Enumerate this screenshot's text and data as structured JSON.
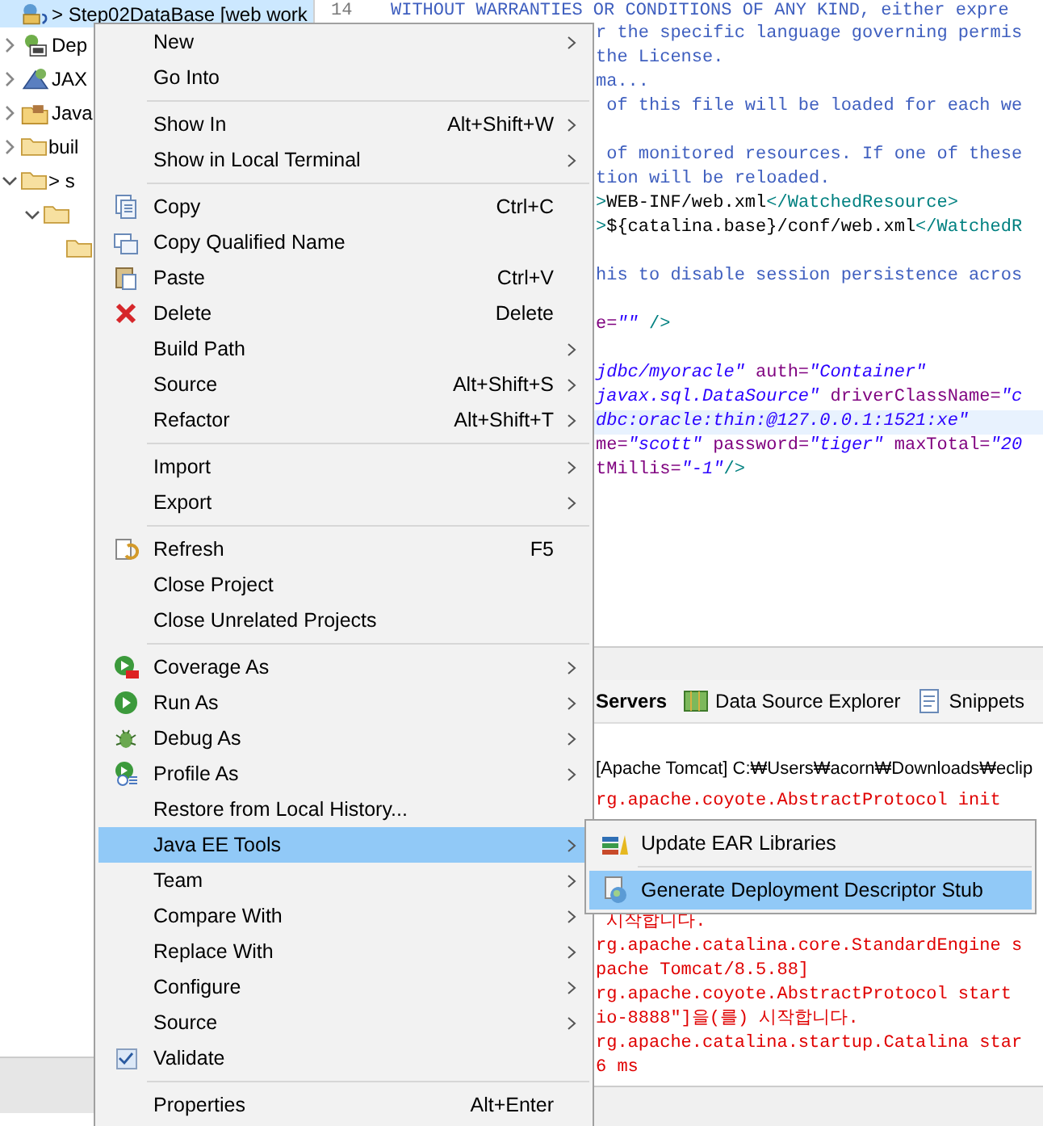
{
  "tree": [
    {
      "label": "> Step02DataBase [web work",
      "selected": true
    },
    {
      "label": "Dep",
      "expanded": false,
      "selected": false
    },
    {
      "label": "JAX",
      "expanded": false,
      "selected": false
    },
    {
      "label": "Java",
      "expanded": false,
      "selected": false
    },
    {
      "label": "buil",
      "expanded": false,
      "selected": false
    },
    {
      "label": "> s",
      "expanded": true,
      "selected": false,
      "children": [
        {
          "expanded": true,
          "selected": false,
          "children": [
            {
              "selected": false
            }
          ]
        }
      ]
    }
  ],
  "editor": {
    "line_number": "14",
    "first_line": "WITHOUT WARRANTIES OR CONDITIONS OF ANY KIND, either expre",
    "lines": [
      {
        "kind": "code",
        "current": false,
        "segments": [
          {
            "kind": "comment",
            "text": "r the specific language governing permis"
          }
        ]
      },
      {
        "kind": "code",
        "current": false,
        "segments": [
          {
            "kind": "comment",
            "text": "the License."
          }
        ]
      },
      {
        "kind": "code",
        "current": false,
        "segments": [
          {
            "kind": "comment",
            "text": "ma..."
          }
        ]
      },
      {
        "kind": "code",
        "current": false,
        "segments": [
          {
            "kind": "comment",
            "text": " of this file will be loaded for each we"
          }
        ]
      },
      {
        "kind": "blank",
        "current": false
      },
      {
        "kind": "code",
        "current": false,
        "segments": [
          {
            "kind": "comment",
            "text": " of monitored resources. If one of these"
          }
        ]
      },
      {
        "kind": "code",
        "current": false,
        "segments": [
          {
            "kind": "comment",
            "text": "tion will be reloaded."
          }
        ]
      },
      {
        "kind": "code",
        "current": false,
        "segments": [
          {
            "kind": "tag",
            "text": ">"
          },
          {
            "kind": "text",
            "text": "WEB-INF/web.xml"
          },
          {
            "kind": "tag",
            "text": "</WatchedResource>"
          }
        ]
      },
      {
        "kind": "code",
        "current": false,
        "segments": [
          {
            "kind": "tag",
            "text": ">"
          },
          {
            "kind": "text",
            "text": "${catalina.base}/conf/web.xml"
          },
          {
            "kind": "tag",
            "text": "</WatchedR"
          }
        ]
      },
      {
        "kind": "blank",
        "current": false
      },
      {
        "kind": "code",
        "current": false,
        "segments": [
          {
            "kind": "comment",
            "text": "his to disable session persistence acros"
          }
        ]
      },
      {
        "kind": "blank",
        "current": false
      },
      {
        "kind": "code",
        "current": false,
        "segments": [
          {
            "kind": "attr",
            "text": "e="
          },
          {
            "kind": "value",
            "text": "\"\""
          },
          {
            "kind": "tag",
            "text": " />"
          }
        ]
      },
      {
        "kind": "blank",
        "current": false
      },
      {
        "kind": "code",
        "current": false,
        "segments": [
          {
            "kind": "value",
            "text": "jdbc/myoracle\""
          },
          {
            "kind": "attr",
            "text": " auth="
          },
          {
            "kind": "value",
            "text": "\"Container\""
          }
        ]
      },
      {
        "kind": "code",
        "current": false,
        "segments": [
          {
            "kind": "value",
            "text": "javax.sql.DataSource\""
          },
          {
            "kind": "attr",
            "text": " driverClassName="
          },
          {
            "kind": "value",
            "text": "\"c"
          }
        ]
      },
      {
        "kind": "code",
        "current": true,
        "segments": [
          {
            "kind": "value",
            "text": "dbc:oracle:thin:@127.0.0.1:1521:xe\""
          }
        ]
      },
      {
        "kind": "code",
        "current": false,
        "segments": [
          {
            "kind": "attr",
            "text": "me="
          },
          {
            "kind": "value",
            "text": "\"scott\""
          },
          {
            "kind": "attr",
            "text": " password="
          },
          {
            "kind": "value",
            "text": "\"tiger\""
          },
          {
            "kind": "attr",
            "text": " maxTotal="
          },
          {
            "kind": "value",
            "text": "\"20"
          }
        ]
      },
      {
        "kind": "code",
        "current": false,
        "segments": [
          {
            "kind": "attr",
            "text": "tMillis="
          },
          {
            "kind": "value",
            "text": "\"-1\""
          },
          {
            "kind": "tag",
            "text": "/>"
          }
        ]
      }
    ]
  },
  "console": {
    "tabs": [
      {
        "label": "Servers",
        "selected": true
      },
      {
        "label": "Data Source Explorer",
        "selected": false
      },
      {
        "label": "Snippets",
        "selected": false
      }
    ],
    "header": "[Apache Tomcat] C:₩Users₩acorn₩Downloads₩eclip",
    "lines_above_menu": [
      "rg.apache.coyote.AbstractProtocol init"
    ],
    "lines_below_menu": [
      " 시작합니다.",
      "rg.apache.catalina.core.StandardEngine s",
      "pache Tomcat/8.5.88]",
      "rg.apache.coyote.AbstractProtocol start",
      "io-8888\"]을(를) 시작합니다.",
      "rg.apache.catalina.startup.Catalina star",
      "6 ms"
    ]
  },
  "context_menu": [
    {
      "kind": "item",
      "label": "New",
      "submenu": true,
      "selected": false
    },
    {
      "kind": "item",
      "label": "Go Into",
      "submenu": false,
      "selected": false
    },
    {
      "kind": "separator"
    },
    {
      "kind": "item",
      "label": "Show In",
      "shortcut": "Alt+Shift+W",
      "submenu": true,
      "selected": false
    },
    {
      "kind": "item",
      "label": "Show in Local Terminal",
      "submenu": true,
      "selected": false
    },
    {
      "kind": "separator"
    },
    {
      "kind": "item",
      "label": "Copy",
      "shortcut": "Ctrl+C",
      "submenu": false,
      "selected": false
    },
    {
      "kind": "item",
      "label": "Copy Qualified Name",
      "submenu": false,
      "selected": false
    },
    {
      "kind": "item",
      "label": "Paste",
      "shortcut": "Ctrl+V",
      "submenu": false,
      "selected": false
    },
    {
      "kind": "item",
      "label": "Delete",
      "shortcut": "Delete",
      "submenu": false,
      "selected": false
    },
    {
      "kind": "item",
      "label": "Build Path",
      "submenu": true,
      "selected": false
    },
    {
      "kind": "item",
      "label": "Source",
      "shortcut": "Alt+Shift+S",
      "submenu": true,
      "selected": false
    },
    {
      "kind": "item",
      "label": "Refactor",
      "shortcut": "Alt+Shift+T",
      "submenu": true,
      "selected": false
    },
    {
      "kind": "separator"
    },
    {
      "kind": "item",
      "label": "Import",
      "submenu": true,
      "selected": false
    },
    {
      "kind": "item",
      "label": "Export",
      "submenu": true,
      "selected": false
    },
    {
      "kind": "separator"
    },
    {
      "kind": "item",
      "label": "Refresh",
      "shortcut": "F5",
      "submenu": false,
      "selected": false
    },
    {
      "kind": "item",
      "label": "Close Project",
      "submenu": false,
      "selected": false
    },
    {
      "kind": "item",
      "label": "Close Unrelated Projects",
      "submenu": false,
      "selected": false
    },
    {
      "kind": "separator"
    },
    {
      "kind": "item",
      "label": "Coverage As",
      "submenu": true,
      "selected": false
    },
    {
      "kind": "item",
      "label": "Run As",
      "submenu": true,
      "selected": false
    },
    {
      "kind": "item",
      "label": "Debug As",
      "submenu": true,
      "selected": false
    },
    {
      "kind": "item",
      "label": "Profile As",
      "submenu": true,
      "selected": false
    },
    {
      "kind": "item",
      "label": "Restore from Local History...",
      "submenu": false,
      "selected": false
    },
    {
      "kind": "item",
      "label": "Java EE Tools",
      "submenu": true,
      "selected": true
    },
    {
      "kind": "item",
      "label": "Team",
      "submenu": true,
      "selected": false
    },
    {
      "kind": "item",
      "label": "Compare With",
      "submenu": true,
      "selected": false
    },
    {
      "kind": "item",
      "label": "Replace With",
      "submenu": true,
      "selected": false
    },
    {
      "kind": "item",
      "label": "Configure",
      "submenu": true,
      "selected": false
    },
    {
      "kind": "item",
      "label": "Source",
      "submenu": true,
      "selected": false
    },
    {
      "kind": "item",
      "label": "Validate",
      "submenu": false,
      "selected": false,
      "checked": true
    },
    {
      "kind": "separator"
    },
    {
      "kind": "item",
      "label": "Properties",
      "shortcut": "Alt+Enter",
      "submenu": false,
      "selected": false
    }
  ],
  "submenu": [
    {
      "kind": "item",
      "label": "Update EAR Libraries",
      "selected": false
    },
    {
      "kind": "separator"
    },
    {
      "kind": "item",
      "label": "Generate Deployment Descriptor Stub",
      "selected": true
    }
  ]
}
